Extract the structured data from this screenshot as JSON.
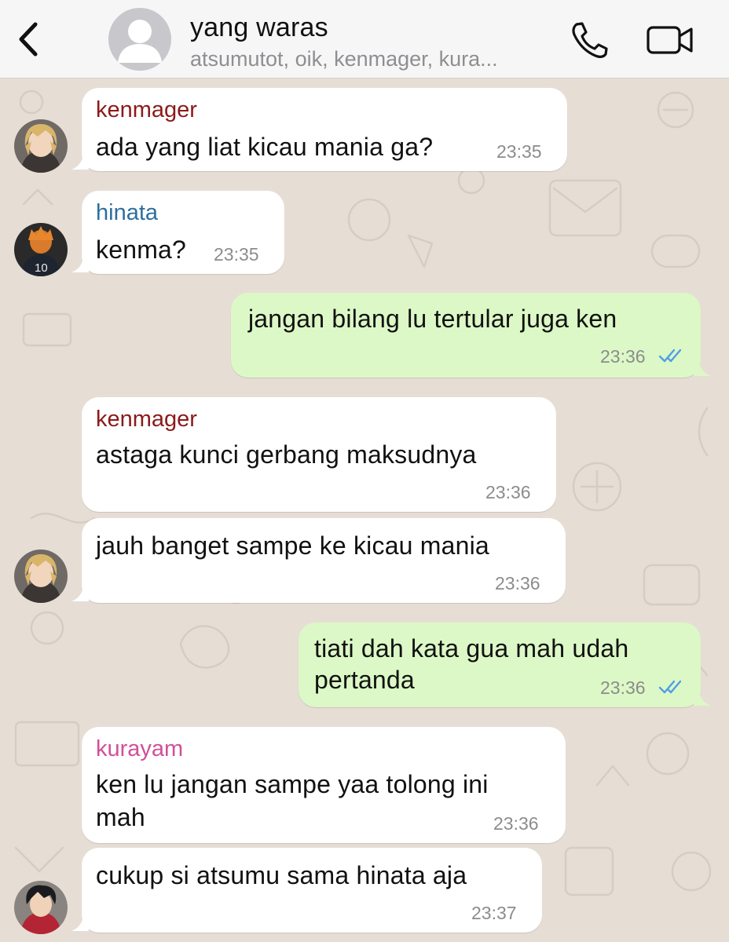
{
  "header": {
    "title": "yang waras",
    "subtitle": "atsumutot, oik, kenmager, kura..."
  },
  "colors": {
    "kenmager": "#8b1a1a",
    "hinata": "#2e6f9e",
    "kurayam": "#d0509a",
    "outgoing_bubble": "#dcf8c6",
    "incoming_bubble": "#ffffff",
    "read_ticks": "#4f9ee6"
  },
  "messages": [
    {
      "sender": "kenmager",
      "text": "ada yang liat kicau mania ga?",
      "time": "23:35"
    },
    {
      "sender": "hinata",
      "text": "kenma?",
      "time": "23:35"
    },
    {
      "text": "jangan bilang lu tertular juga ken",
      "time": "23:36"
    },
    {
      "sender": "kenmager",
      "text": "astaga kunci gerbang maksudnya",
      "time": "23:36"
    },
    {
      "text": "jauh banget sampe ke kicau mania",
      "time": "23:36"
    },
    {
      "line1": "tiati dah kata gua mah udah",
      "line2": "pertanda",
      "time": "23:36"
    },
    {
      "sender": "kurayam",
      "line1": "ken lu jangan sampe yaa tolong ini",
      "line2": "mah",
      "time": "23:36"
    },
    {
      "text": "cukup si atsumu sama hinata aja",
      "time": "23:37"
    }
  ]
}
